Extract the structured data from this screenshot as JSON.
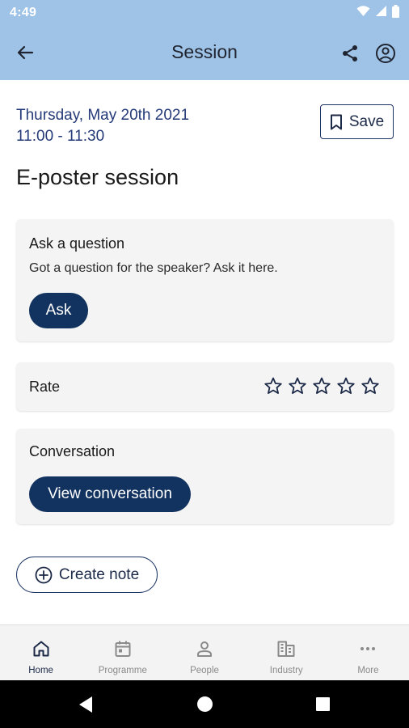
{
  "status_bar": {
    "time": "4:49"
  },
  "app_bar": {
    "title": "Session"
  },
  "session": {
    "date": "Thursday, May 20th 2021",
    "time_range": "11:00 - 11:30",
    "title": "E-poster session",
    "save_label": "Save"
  },
  "ask_card": {
    "heading": "Ask a question",
    "text": "Got a question for the speaker? Ask it here.",
    "button_label": "Ask"
  },
  "rate_card": {
    "label": "Rate",
    "rating": 0,
    "max_rating": 5
  },
  "conversation_card": {
    "heading": "Conversation",
    "button_label": "View conversation"
  },
  "create_note_label": "Create note",
  "bottom_nav": {
    "items": [
      {
        "label": "Home",
        "icon": "home-icon",
        "active": true
      },
      {
        "label": "Programme",
        "icon": "calendar-icon",
        "active": false
      },
      {
        "label": "People",
        "icon": "person-icon",
        "active": false
      },
      {
        "label": "Industry",
        "icon": "building-icon",
        "active": false
      },
      {
        "label": "More",
        "icon": "more-dots-icon",
        "active": false
      }
    ]
  },
  "colors": {
    "app_bar_bg": "#9fc3e6",
    "primary_dark": "#12335f",
    "date_text": "#253a78",
    "card_bg": "#f4f4f4"
  }
}
